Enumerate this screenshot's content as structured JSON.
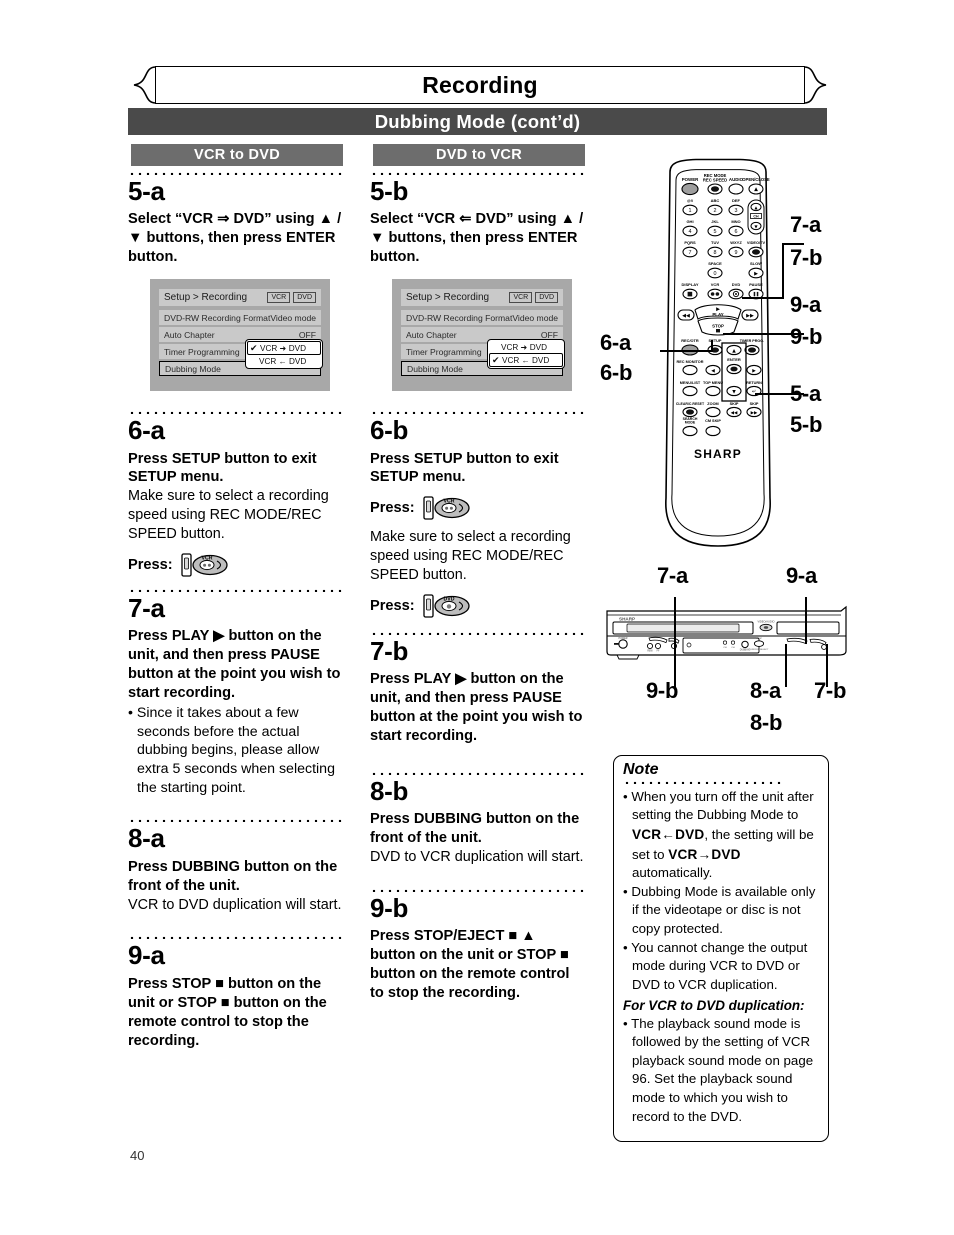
{
  "header": {
    "chapter_title": "Recording",
    "section_title": "Dubbing Mode (cont’d)",
    "col_a_header": "VCR to DVD",
    "col_b_header": "DVD to VCR"
  },
  "page_number": "40",
  "osd": {
    "title": "Setup > Recording",
    "tag_vcr": "VCR",
    "tag_dvd": "DVD",
    "rows": [
      {
        "label": "DVD-RW Recording Format",
        "value": "Video mode"
      },
      {
        "label": "Auto Chapter",
        "value": "OFF"
      },
      {
        "label": "Timer Programming",
        "value": ""
      },
      {
        "label": "Dubbing Mode",
        "value": ""
      }
    ],
    "popup_a": [
      {
        "check": "✔",
        "label": "VCR ➜ DVD",
        "selected": true
      },
      {
        "check": "",
        "label": "VCR ← DVD",
        "selected": false
      }
    ],
    "popup_b": [
      {
        "check": "",
        "label": "VCR ➜ DVD",
        "selected": false
      },
      {
        "check": "✔",
        "label": "VCR ← DVD",
        "selected": true
      }
    ]
  },
  "col_a": {
    "step5": {
      "num": "5-a",
      "bold": "Select “VCR ⇒ DVD” using ▲ / ▼ buttons, then press ENTER button."
    },
    "step6": {
      "num": "6-a",
      "bold": "Press SETUP button to exit SETUP menu.",
      "text": "Make sure to select a recording speed using REC MODE/REC SPEED button.",
      "press_label": "Press:",
      "press_icon": "vcr-tape-disc-icon"
    },
    "step7": {
      "num": "7-a",
      "bold": "Press PLAY ▶ button on the unit, and then press PAUSE button at the point you wish to start recording.",
      "bullet": "Since it takes about a few seconds before the actual dubbing begins, please allow extra 5 seconds when selecting the starting point."
    },
    "step8": {
      "num": "8-a",
      "bold": "Press DUBBING button on the front of the unit.",
      "text": "VCR to DVD duplication will start."
    },
    "step9": {
      "num": "9-a",
      "bold": "Press STOP ■ button on the unit or STOP ■ button on the remote control to stop the recording."
    }
  },
  "col_b": {
    "step5": {
      "num": "5-b",
      "bold": "Select “VCR ⇐ DVD” using ▲ / ▼ buttons, then press ENTER button."
    },
    "step6": {
      "num": "6-b",
      "bold": "Press SETUP button to exit SETUP menu.",
      "press_label_1": "Press:",
      "press_icon_1": "vcr-tape-disc-icon",
      "text": "Make sure to select a recording speed using REC MODE/REC SPEED button.",
      "press_label_2": "Press:",
      "press_icon_2": "dvd-tape-disc-icon"
    },
    "step7": {
      "num": "7-b",
      "bold": "Press PLAY ▶ button on the unit, and then press PAUSE button at the point you wish to start recording."
    },
    "step8": {
      "num": "8-b",
      "bold": "Press DUBBING button on the front of the unit.",
      "text": "DVD to VCR duplication will start."
    },
    "step9": {
      "num": "9-b",
      "bold": "Press STOP/EJECT ■ ▲ button on the unit or STOP ■ button on the remote control to stop the recording."
    }
  },
  "note": {
    "title": "Note",
    "items": [
      "When you turn off the unit after setting the Dubbing Mode to",
      "Dubbing Mode is available only if the videotape or disc is not copy protected.",
      "You cannot change the output mode during VCR to DVD or DVD to VCR duplication."
    ],
    "item1_mode_a": "VCR←DVD",
    "item1_mid": ", the setting will be set to",
    "item1_mode_b": "VCR→DVD",
    "item1_tail": "automatically.",
    "subheading": "For VCR to DVD duplication:",
    "sub_item": "The playback sound mode is followed by the setting of VCR playback sound mode on page 96. Set the playback sound mode to which you wish to record to the DVD."
  },
  "remote": {
    "brand": "SHARP",
    "labels": {
      "power": "POWER",
      "rec_mode": "REC MODE",
      "rec_speed": "REC SPEED",
      "audio": "AUDIO",
      "open_close": "OPEN/CLOSE",
      "k1": "@!/",
      "k2": "ABC",
      "k3": "DEF",
      "k4": "GHI",
      "k5": "JKL",
      "k6": "MNO",
      "k7": "PQRS",
      "k8": "TUV",
      "k9": "WXYZ",
      "k0": "SPACE",
      "ch": "CH",
      "video_tv": "VIDEO/TV",
      "slow": "SLOW",
      "display": "DISPLAY",
      "vcr": "VCR",
      "dvd": "DVD",
      "pause": "PAUSE",
      "play": "PLAY",
      "stop": "STOP",
      "rec_otr": "REC/OTR",
      "setup": "SETUP",
      "timer_prog": "TIMER PROG.",
      "rec_monitor": "REC MONITOR",
      "enter": "ENTER",
      "menu_list": "MENU/LIST",
      "top_menu": "TOP MENU",
      "return": "RETURN",
      "clear": "CLEAR/C.RESET",
      "zoom": "ZOOM",
      "skip_l": "SKIP",
      "skip_r": "SKIP",
      "search_mode": "SEARCH MODE",
      "cm_skip": "CM SKIP",
      "num1": "1",
      "num2": "2",
      "num3": "3",
      "num4": "4",
      "num5": "5",
      "num6": "6",
      "num7": "7",
      "num8": "8",
      "num9": "9",
      "num0": "0"
    },
    "callouts": {
      "c7a": "7-a",
      "c7b": "7-b",
      "c9a": "9-a",
      "c9b": "9-b",
      "c6a": "6-a",
      "c6b": "6-b",
      "c5a": "5-a",
      "c5b": "5-b"
    }
  },
  "front_panel": {
    "brand": "SHARP",
    "callouts": {
      "c7a": "7-a",
      "c9a": "9-a",
      "c9b": "9-b",
      "c8a": "8-a",
      "c8b": "8-b",
      "c7b": "7-b"
    }
  }
}
